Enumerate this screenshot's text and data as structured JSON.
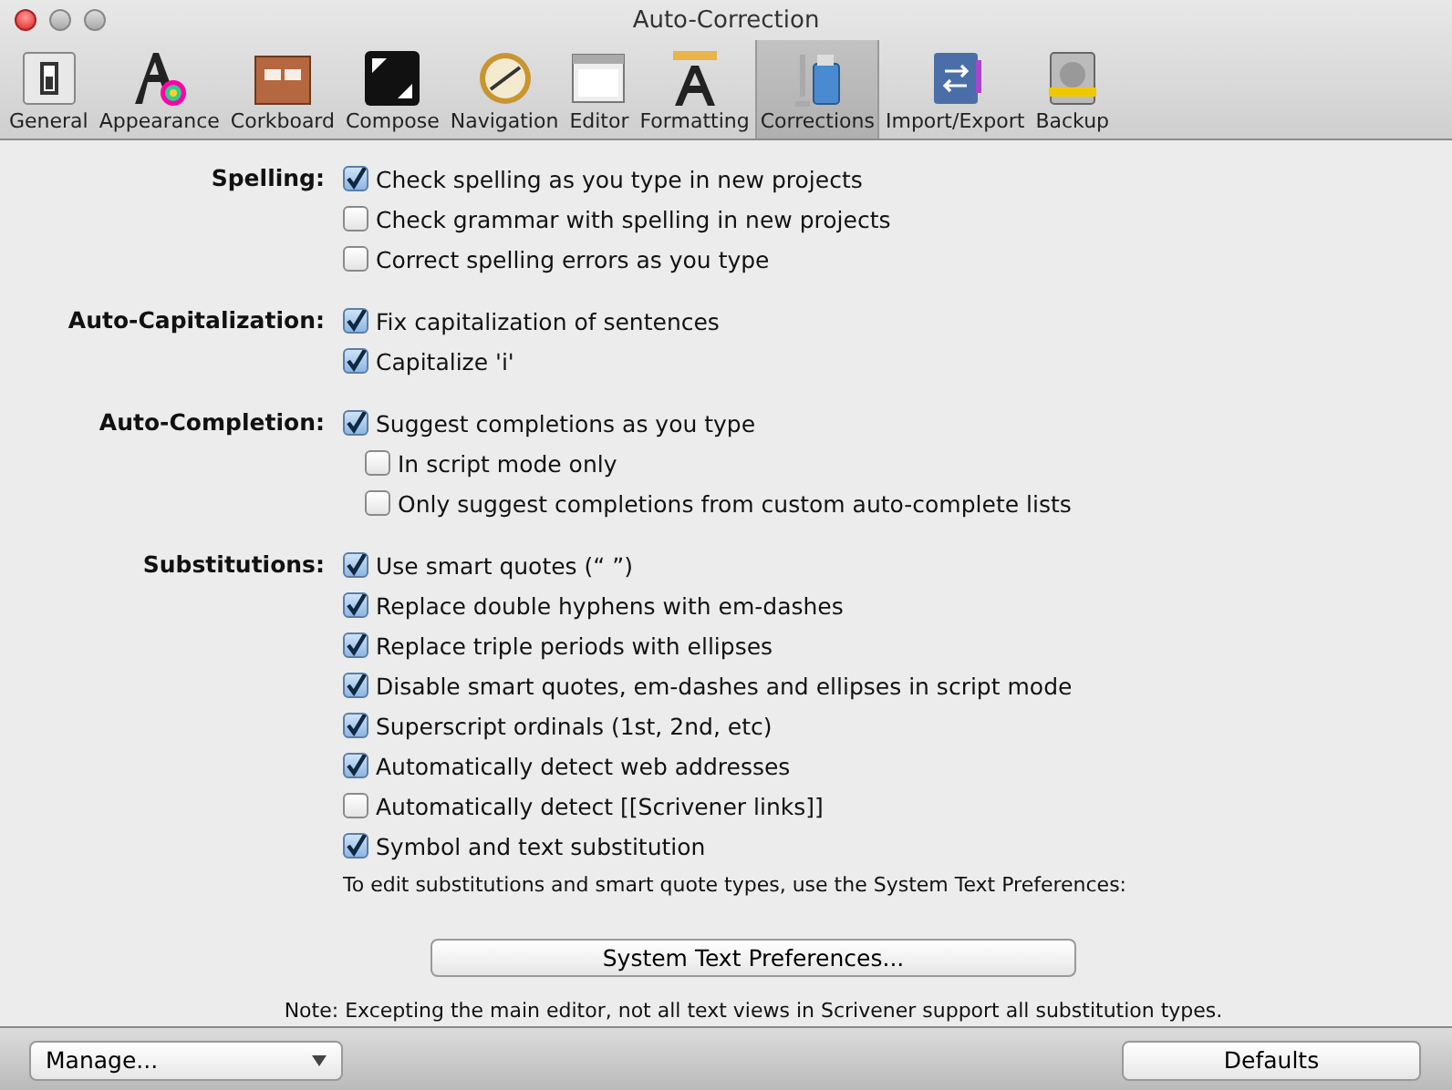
{
  "window": {
    "title": "Auto-Correction"
  },
  "toolbar": [
    {
      "label": "General",
      "selected": false
    },
    {
      "label": "Appearance",
      "selected": false
    },
    {
      "label": "Corkboard",
      "selected": false
    },
    {
      "label": "Compose",
      "selected": false
    },
    {
      "label": "Navigation",
      "selected": false
    },
    {
      "label": "Editor",
      "selected": false
    },
    {
      "label": "Formatting",
      "selected": false
    },
    {
      "label": "Corrections",
      "selected": true
    },
    {
      "label": "Import/Export",
      "selected": false
    },
    {
      "label": "Backup",
      "selected": false
    }
  ],
  "groups": [
    {
      "label": "Spelling:",
      "options": [
        {
          "label": "Check spelling as you type in new projects",
          "checked": true
        },
        {
          "label": "Check grammar with spelling in new projects",
          "checked": false
        },
        {
          "label": "Correct spelling errors as you type",
          "checked": false
        }
      ]
    },
    {
      "label": "Auto-Capitalization:",
      "options": [
        {
          "label": "Fix capitalization of sentences",
          "checked": true
        },
        {
          "label": "Capitalize 'i'",
          "checked": true
        }
      ]
    },
    {
      "label": "Auto-Completion:",
      "options": [
        {
          "label": "Suggest completions as you type",
          "checked": true,
          "children": [
            {
              "label": "In script mode only",
              "checked": false
            },
            {
              "label": "Only suggest completions from custom auto-complete lists",
              "checked": false
            }
          ]
        }
      ]
    },
    {
      "label": "Substitutions:",
      "options": [
        {
          "label": "Use smart quotes (“ ”)",
          "checked": true
        },
        {
          "label": "Replace double hyphens with em-dashes",
          "checked": true
        },
        {
          "label": "Replace triple periods with ellipses",
          "checked": true
        },
        {
          "label": "Disable smart quotes, em-dashes and ellipses in script mode",
          "checked": true
        },
        {
          "label": "Superscript ordinals (1st, 2nd, etc)",
          "checked": true
        },
        {
          "label": "Automatically detect web addresses",
          "checked": true
        },
        {
          "label": "Automatically detect [[Scrivener links]]",
          "checked": false
        },
        {
          "label": "Symbol and text substitution",
          "checked": true
        }
      ],
      "hint": "To edit substitutions and smart quote types, use the System Text Preferences:"
    }
  ],
  "system_button": "System Text Preferences...",
  "note": "Note: Excepting the main editor, not all text views in Scrivener support all substitution types.",
  "bottom_bar": {
    "manage": "Manage...",
    "defaults": "Defaults"
  }
}
